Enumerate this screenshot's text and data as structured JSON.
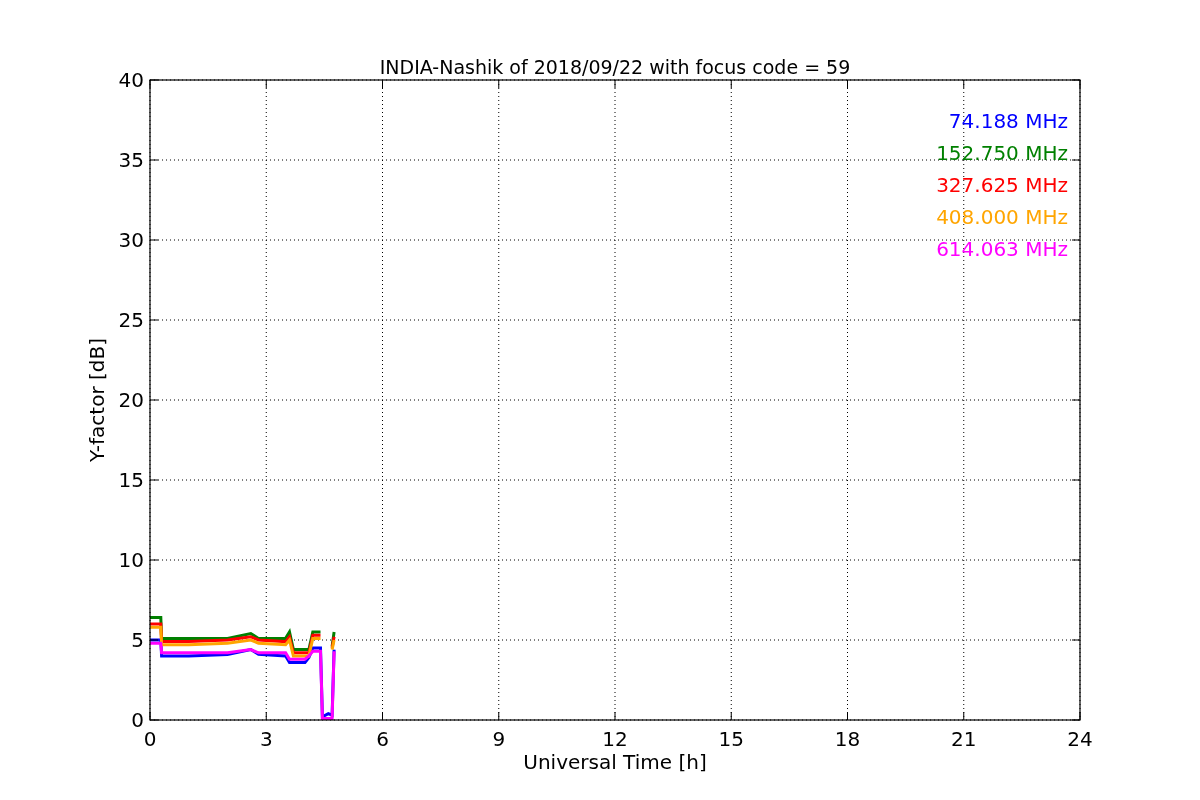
{
  "chart_data": {
    "type": "line",
    "title": "INDIA-Nashik of 2018/09/22 with focus code = 59",
    "xlabel": "Universal Time [h]",
    "ylabel": "Y-factor [dB]",
    "x": [
      0,
      0.28,
      0.3,
      1,
      2,
      2.6,
      2.8,
      3.5,
      3.6,
      3.7,
      4.0,
      4.1,
      4.2,
      4.4,
      4.45,
      4.6,
      4.7,
      4.75
    ],
    "series": [
      {
        "name": "74.188 MHz",
        "color": "#0000ff",
        "values": [
          5.0,
          5.0,
          4.0,
          4.0,
          4.1,
          4.4,
          4.1,
          4.0,
          3.6,
          3.6,
          3.6,
          3.9,
          4.5,
          4.5,
          0.2,
          0.4,
          0.3,
          4.4
        ]
      },
      {
        "name": "152.750 MHz",
        "color": "#008000",
        "values": [
          6.4,
          6.4,
          5.1,
          5.1,
          5.1,
          5.4,
          5.1,
          5.1,
          5.5,
          4.4,
          4.4,
          4.4,
          5.5,
          5.5,
          null,
          null,
          4.6,
          5.5
        ]
      },
      {
        "name": "327.625 MHz",
        "color": "#ff0000",
        "values": [
          6.0,
          6.0,
          4.9,
          4.9,
          5.0,
          5.2,
          5.0,
          4.9,
          5.2,
          4.2,
          4.2,
          4.2,
          5.3,
          5.3,
          null,
          null,
          4.5,
          5.2
        ]
      },
      {
        "name": "408.000 MHz",
        "color": "#ffa500",
        "values": [
          5.8,
          5.8,
          4.7,
          4.7,
          4.8,
          5.0,
          4.8,
          4.7,
          5.0,
          4.0,
          4.0,
          4.0,
          5.1,
          5.1,
          null,
          null,
          4.4,
          5.0
        ]
      },
      {
        "name": "614.063 MHz",
        "color": "#ff00ff",
        "values": [
          4.8,
          4.8,
          4.2,
          4.2,
          4.2,
          4.4,
          4.2,
          4.2,
          3.8,
          3.8,
          3.8,
          4.0,
          4.3,
          4.3,
          0.1,
          0.1,
          0.1,
          4.3
        ]
      }
    ],
    "xlim": [
      0,
      24
    ],
    "ylim": [
      0,
      40
    ],
    "grid": true,
    "xticks": [
      0,
      3,
      6,
      9,
      12,
      15,
      18,
      21,
      24
    ],
    "yticks": [
      0,
      5,
      10,
      15,
      20,
      25,
      30,
      35,
      40
    ]
  }
}
